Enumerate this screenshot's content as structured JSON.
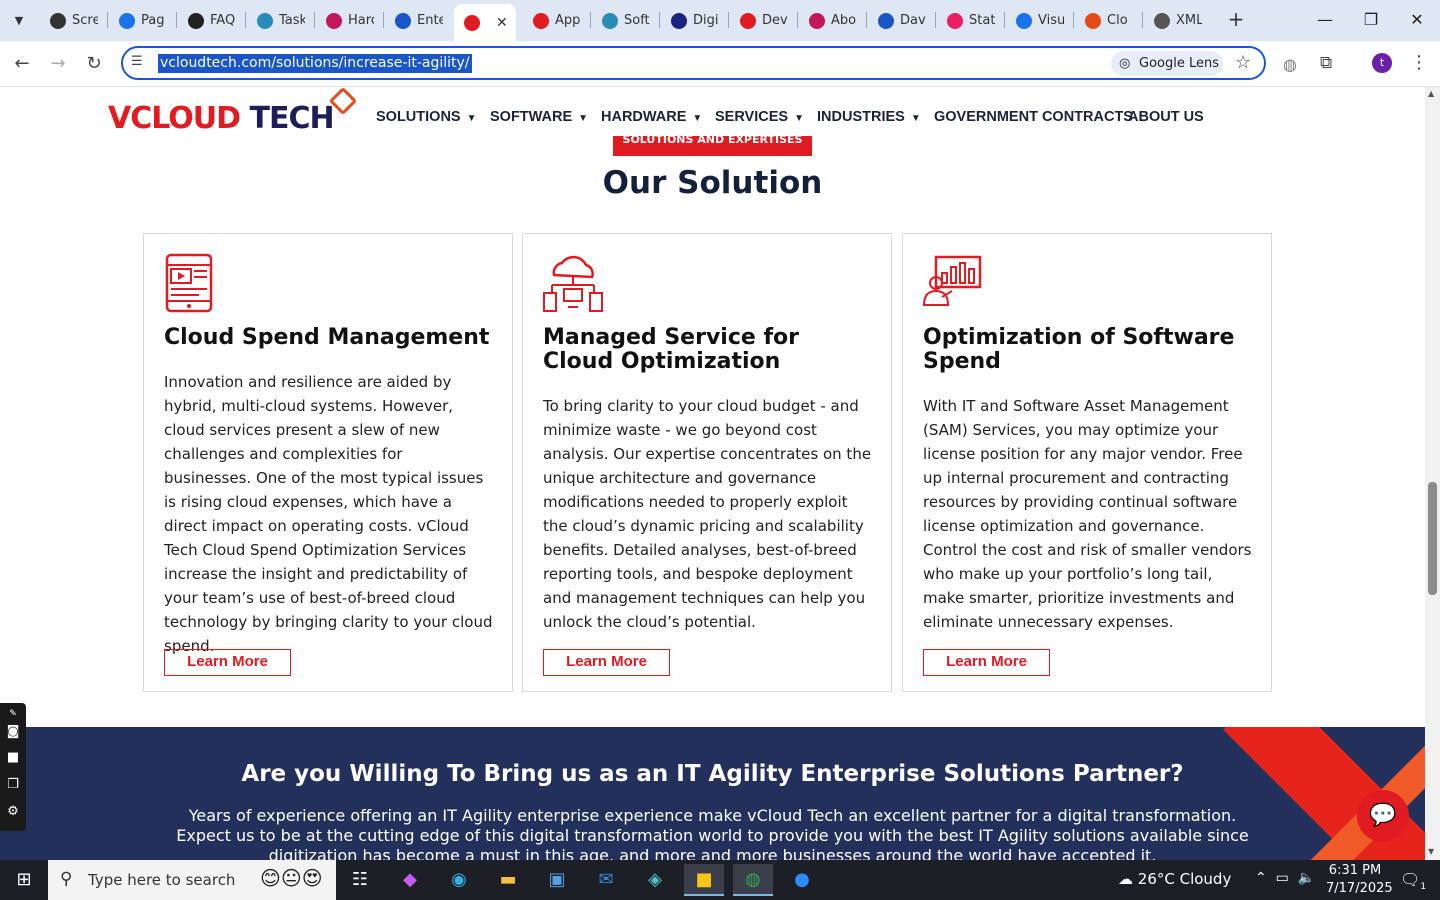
{
  "browser": {
    "tabs": [
      {
        "label": "Scre",
        "color": "#333333"
      },
      {
        "label": "Pag",
        "color": "#1a73e8"
      },
      {
        "label": "FAQ",
        "color": "#222222"
      },
      {
        "label": "Task",
        "color": "#2a8ab8"
      },
      {
        "label": "Harc",
        "color": "#c2185b"
      },
      {
        "label": "Ente",
        "color": "#1a56c8"
      },
      {
        "label": "",
        "color": "#e11b22",
        "active": true
      },
      {
        "label": "App",
        "color": "#e11b22"
      },
      {
        "label": "Soft",
        "color": "#2a8ab8"
      },
      {
        "label": "Digi",
        "color": "#1a237e"
      },
      {
        "label": "Dev",
        "color": "#e11b22"
      },
      {
        "label": "Abo",
        "color": "#c2185b"
      },
      {
        "label": "Dav",
        "color": "#1a56c8"
      },
      {
        "label": "Stat",
        "color": "#e91e63"
      },
      {
        "label": "Visu",
        "color": "#1a73e8"
      },
      {
        "label": "Clo",
        "color": "#e64a19"
      },
      {
        "label": "XML",
        "color": "#555555"
      }
    ],
    "close_glyph": "✕",
    "new_tab_glyph": "+",
    "url": "vcloudtech.com/solutions/increase-it-agility/",
    "lens_label": "Google Lens",
    "profile_initial": "t",
    "window": {
      "minimize": "—",
      "maximize": "❐",
      "close": "✕"
    }
  },
  "site": {
    "logo": {
      "v": "V",
      "cloud": "CLOUD",
      "tech": " TECH"
    },
    "nav": [
      {
        "label": "SOLUTIONS",
        "caret": true
      },
      {
        "label": "SOFTWARE",
        "caret": true
      },
      {
        "label": "HARDWARE",
        "caret": true
      },
      {
        "label": "SERVICES",
        "caret": true
      },
      {
        "label": "INDUSTRIES",
        "caret": true
      },
      {
        "label": "GOVERNMENT CONTRACTS",
        "caret": false
      },
      {
        "label": "ABOUT US",
        "caret": false
      }
    ],
    "eyebrow": "SOLUTIONS AND EXPERTISES",
    "section_title": "Our Solution",
    "cards": [
      {
        "title": "Cloud Spend Management",
        "body": "Innovation and resilience are aided by hybrid, multi-cloud systems. However, cloud services present a slew of new challenges and complexities for businesses. One of the most typical issues is rising cloud expenses, which have a direct impact on operating costs. vCloud Tech Cloud Spend Optimization Services increase the insight and predictability of your team’s use of best-of-breed cloud technology by bringing clarity to your cloud spend.",
        "button": "Learn More",
        "icon": "tablet-video-icon"
      },
      {
        "title": "Managed Service for Cloud Optimization",
        "body": "To bring clarity to your cloud budget - and minimize waste - we go beyond cost analysis. Our expertise concentrates on the unique architecture and governance modifications needed to properly exploit the cloud’s dynamic pricing and scalability benefits. Detailed analyses, best-of-breed reporting tools, and bespoke deployment and management techniques can help you unlock the cloud’s potential.",
        "button": "Learn More",
        "icon": "cloud-network-icon"
      },
      {
        "title": "Optimization of Software Spend",
        "body": "With IT and Software Asset Management (SAM) Services, you may optimize your license position for any major vendor. Free up internal procurement and contracting resources by providing continual software license optimization and governance. Control the cost and risk of smaller vendors who make up your portfolio’s long tail, make smarter, prioritize investments and eliminate unnecessary expenses.",
        "button": "Learn More",
        "icon": "analytics-presenter-icon"
      }
    ],
    "cta": {
      "title": "Are you Willing To Bring us as an IT Agility Enterprise Solutions Partner?",
      "text": "Years of experience offering an IT Agility enterprise experience make vCloud Tech an excellent partner for a digital transformation. Expect us to be at the cutting edge of this digital transformation world to provide you with the best IT Agility solutions available since digitization has become a must in this age, and more and more businesses around the world have accepted it."
    }
  },
  "taskbar": {
    "search_placeholder": "Type here to search",
    "weather": "26°C  Cloudy",
    "time": "6:31 PM",
    "date": "7/17/2025",
    "notifications": "1"
  },
  "colors": {
    "brand_red": "#e11b22",
    "navy": "#23305c",
    "title_navy": "#15203b"
  }
}
